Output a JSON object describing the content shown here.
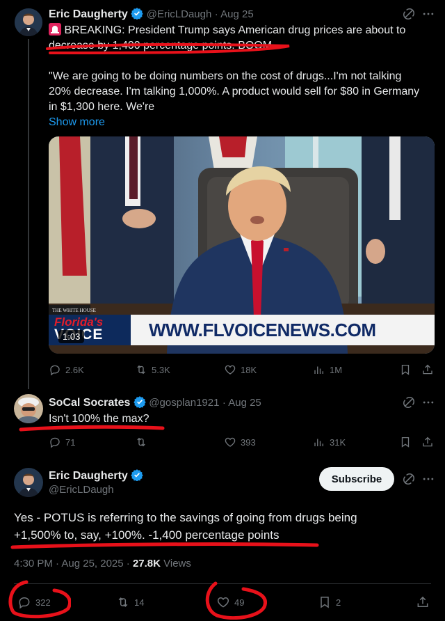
{
  "tweet1": {
    "author_name": "Eric Daugherty",
    "handle": "@EricLDaugh",
    "time": "Aug 25",
    "text_line1": "BREAKING: President Trump says American drug prices are about to",
    "text_line2": "decrease by 1,400 percentage points. BOOM.",
    "quote_line1": "\"We are going to be doing numbers on the cost of drugs...I'm not talking",
    "quote_line2": "20% decrease. I'm talking 1,000%. A product would sell for $80 in Germany",
    "quote_line3": "in $1,300 here. We're",
    "show_more": "Show more",
    "video": {
      "duration": "1:03",
      "banner_logo_top": "Florida's",
      "banner_logo_bottom": "VOICE",
      "banner_url": "WWW.FLVOICENEWS.COM",
      "podium_text": "THE WHITE HOUSE"
    },
    "stats": {
      "replies": "2.6K",
      "reposts": "5.3K",
      "likes": "18K",
      "views": "1M"
    }
  },
  "tweet2": {
    "author_name": "SoCal Socrates",
    "handle": "@gosplan1921",
    "time": "Aug 25",
    "text": "Isn't 100% the max?",
    "stats": {
      "replies": "71",
      "reposts": "",
      "likes": "393",
      "views": "31K"
    }
  },
  "tweet3": {
    "author_name": "Eric Daugherty",
    "handle": "@EricLDaugh",
    "subscribe_label": "Subscribe",
    "text_line1": "Yes - POTUS is referring to the savings of going from drugs being",
    "text_line2": "+1,500% to, say, +100%. -1,400 percentage points",
    "timestamp": "4:30 PM · Aug 25, 2025 · ",
    "views_count": "27.8K",
    "views_label": " Views",
    "stats": {
      "replies": "322",
      "reposts": "14",
      "likes": "49",
      "bookmarks": "2"
    }
  },
  "colors": {
    "accent": "#1d9bf0",
    "annotation": "#e8111a",
    "alert": "#e0245e"
  },
  "icons": [
    "grok-icon",
    "more-icon",
    "reply-icon",
    "repost-icon",
    "like-icon",
    "views-icon",
    "bookmark-icon",
    "share-icon",
    "verified-icon",
    "siren-icon"
  ]
}
